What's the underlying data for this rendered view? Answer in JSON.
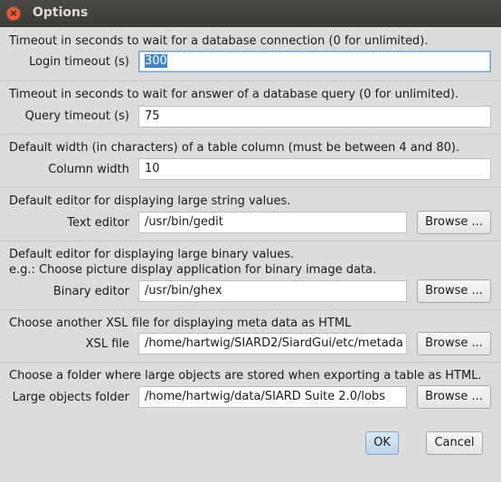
{
  "window": {
    "title": "Options",
    "close_glyph": "×"
  },
  "login_timeout": {
    "description": "Timeout in seconds to wait for a database connection (0 for unlimited).",
    "label": "Login timeout (s)",
    "value": "300"
  },
  "query_timeout": {
    "description": "Timeout in seconds to wait for answer of a database query (0 for unlimited).",
    "label": "Query timeout (s)",
    "value": "75"
  },
  "column_width": {
    "description": "Default width (in characters) of a table column (must be between 4 and 80).",
    "label": "Column width",
    "value": "10"
  },
  "text_editor": {
    "description": "Default editor for displaying large string values.",
    "label": "Text editor",
    "value": "/usr/bin/gedit",
    "browse_label": "Browse ..."
  },
  "binary_editor": {
    "description": "Default editor for displaying large binary values.",
    "description2": "e.g.: Choose picture display application for binary image data.",
    "label": "Binary editor",
    "value": "/usr/bin/ghex",
    "browse_label": "Browse ..."
  },
  "xsl_file": {
    "description": "Choose another XSL file for displaying meta data as HTML",
    "label": "XSL file",
    "value": "/home/hartwig/SIARD2/SiardGui/etc/metada",
    "browse_label": "Browse ..."
  },
  "lobs_folder": {
    "description": "Choose a folder where large objects are stored when exporting a table as HTML.",
    "label": "Large objects folder",
    "value": "/home/hartwig/data/SIARD Suite 2.0/lobs",
    "browse_label": "Browse ..."
  },
  "buttons": {
    "ok": "OK",
    "cancel": "Cancel"
  }
}
